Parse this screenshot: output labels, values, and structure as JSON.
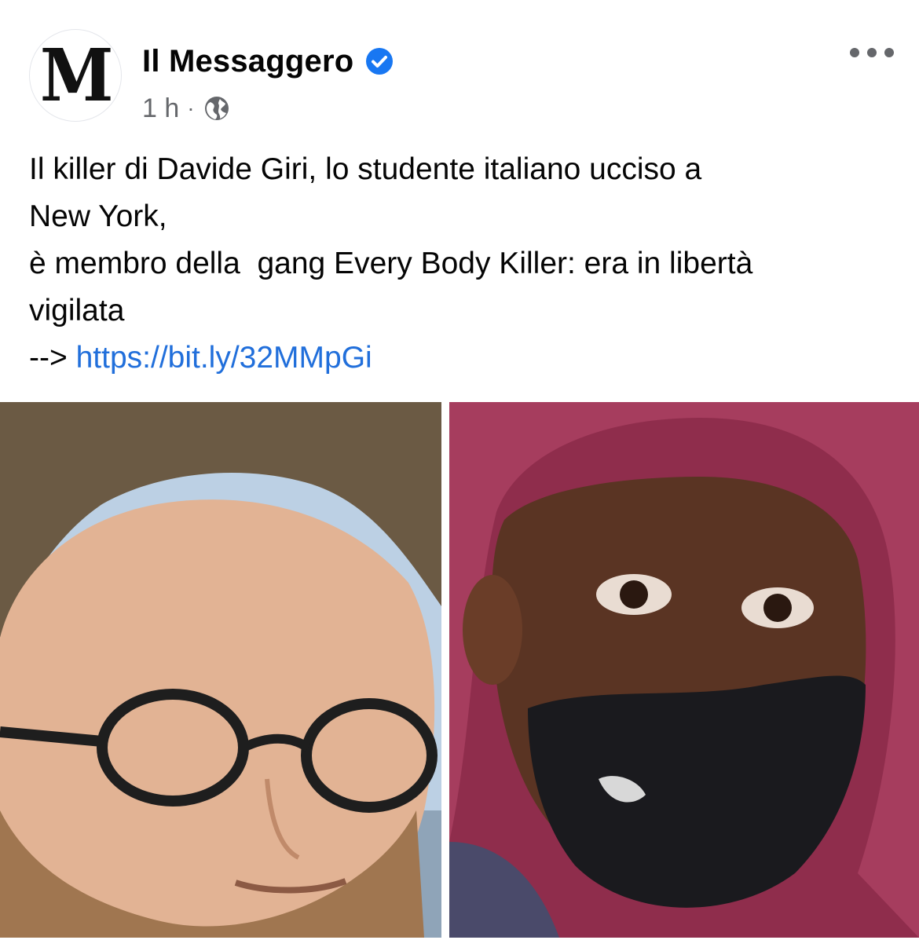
{
  "post": {
    "author": {
      "name": "Il Messaggero",
      "avatar_letter": "M",
      "verified": true,
      "verified_icon": "verified-badge-icon",
      "verified_color": "#1877f2"
    },
    "meta": {
      "time": "1 h",
      "separator": "·",
      "audience_icon": "globe-icon"
    },
    "more_icon": "more-options-icon",
    "text": {
      "line1": "Il killer di Davide Giri, lo studente italiano ucciso a\nNew York,\nè membro della  gang Every Body Killer: era in libertà\nvigilata\n--> ",
      "link": "https://bit.ly/32MMpGi",
      "link_color": "#216fdb"
    },
    "media": {
      "type": "photo-collage",
      "panels": 2
    }
  }
}
